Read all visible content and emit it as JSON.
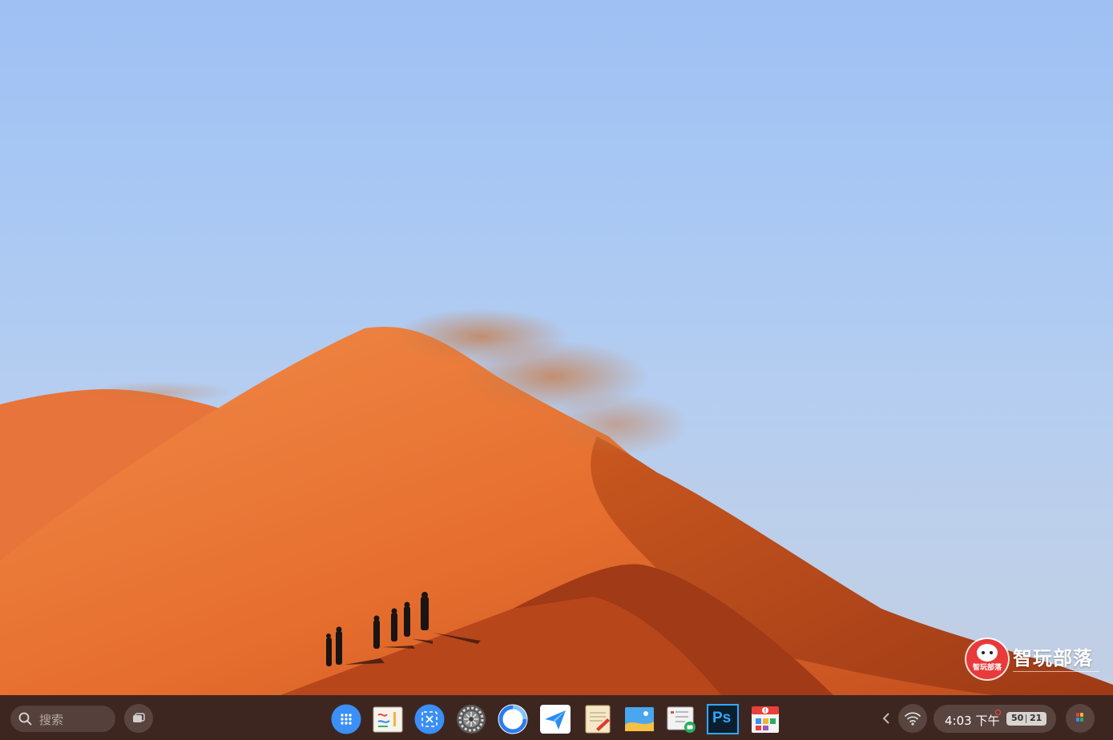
{
  "watermark": {
    "title": "智玩部落",
    "badge_text": "智玩部落"
  },
  "taskbar": {
    "search": {
      "placeholder": "搜索",
      "icon": "search-icon"
    },
    "overview_icon": "overview-icon",
    "apps": [
      {
        "name": "app-launcher",
        "icon": "grid-icon"
      },
      {
        "name": "sketch-app",
        "icon": "whiteboard-icon"
      },
      {
        "name": "screenshot-app",
        "icon": "screenshot-icon"
      },
      {
        "name": "settings-app",
        "icon": "gear-icon"
      },
      {
        "name": "browser-app",
        "icon": "browser-icon"
      },
      {
        "name": "send-app",
        "icon": "paper-plane-icon"
      },
      {
        "name": "notes-app",
        "icon": "notepad-icon"
      },
      {
        "name": "photos-app",
        "icon": "landscape-icon"
      },
      {
        "name": "files-app",
        "icon": "file-manager-icon"
      },
      {
        "name": "photoshop-app",
        "label": "Ps",
        "icon": "photoshop-icon"
      },
      {
        "name": "store-app",
        "icon": "app-store-icon"
      }
    ],
    "tray": {
      "chevron": "chevron-left-icon",
      "wifi": "wifi-icon",
      "time": "4:03 下午",
      "battery_left": "50",
      "battery_right": "21"
    },
    "assistant_icon": "assistant-icon"
  },
  "colors": {
    "taskbar": "#3e2620",
    "accent_blue": "#3b8ff6",
    "dune_orange": "#e8733a",
    "sky_blue": "#a9c8f3"
  }
}
